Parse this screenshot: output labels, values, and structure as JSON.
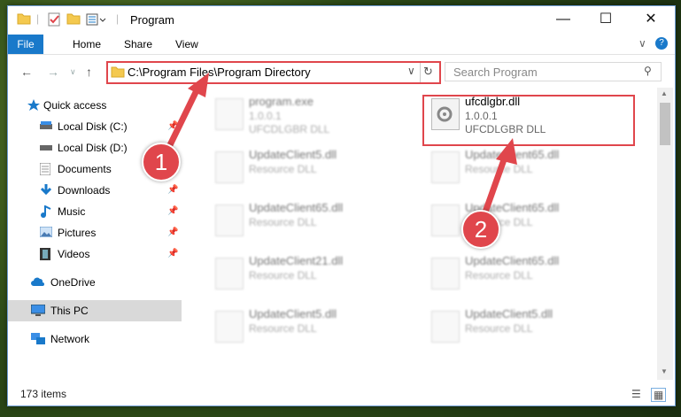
{
  "window": {
    "title": "Program",
    "minimize_icon": "minimize-icon",
    "maximize_icon": "maximize-icon",
    "close_icon": "close-icon"
  },
  "ribbon": {
    "file": "File",
    "tabs": [
      "Home",
      "Share",
      "View"
    ],
    "help_icon": "help-icon",
    "expand_icon": "chevron-down-icon"
  },
  "address": {
    "path": "C:\\Program Files\\Program Directory",
    "refresh_icon": "refresh-icon",
    "dropdown_icon": "chevron-down-icon"
  },
  "search": {
    "placeholder": "Search Program"
  },
  "sidebar": {
    "items": [
      {
        "label": "Quick access",
        "icon": "star-icon"
      },
      {
        "label": "Local Disk (C:)",
        "icon": "drive-icon"
      },
      {
        "label": "Local Disk (D:)",
        "icon": "drive-icon"
      },
      {
        "label": "Documents",
        "icon": "documents-icon"
      },
      {
        "label": "Downloads",
        "icon": "download-icon"
      },
      {
        "label": "Music",
        "icon": "music-icon"
      },
      {
        "label": "Pictures",
        "icon": "pictures-icon"
      },
      {
        "label": "Videos",
        "icon": "videos-icon"
      },
      {
        "label": "OneDrive",
        "icon": "cloud-icon"
      },
      {
        "label": "This PC",
        "icon": "computer-icon"
      },
      {
        "label": "Network",
        "icon": "network-icon"
      }
    ]
  },
  "files": [
    {
      "name": "program.exe",
      "line2": "1.0.0.1",
      "line3": "UFCDLGBR DLL"
    },
    {
      "name": "ufcdlgbr.dll",
      "line2": "1.0.0.1",
      "line3": "UFCDLGBR DLL"
    },
    {
      "name": "UpdateClient5.dll",
      "line2": "Resource DLL",
      "line3": ""
    },
    {
      "name": "UpdateClient65.dll",
      "line2": "Resource DLL",
      "line3": ""
    },
    {
      "name": "UpdateClient65.dll",
      "line2": "Resource DLL",
      "line3": ""
    },
    {
      "name": "UpdateClient65.dll",
      "line2": "Resource DLL",
      "line3": ""
    },
    {
      "name": "UpdateClient21.dll",
      "line2": "Resource DLL",
      "line3": ""
    },
    {
      "name": "UpdateClient65.dll",
      "line2": "Resource DLL",
      "line3": ""
    },
    {
      "name": "UpdateClient5.dll",
      "line2": "Resource DLL",
      "line3": ""
    },
    {
      "name": "UpdateClient5.dll",
      "line2": "Resource DLL",
      "line3": ""
    }
  ],
  "status": {
    "count": "173 items"
  },
  "annotations": {
    "step1": "1",
    "step2": "2"
  },
  "colors": {
    "accent": "#1979ca",
    "highlight": "#e0464c"
  }
}
